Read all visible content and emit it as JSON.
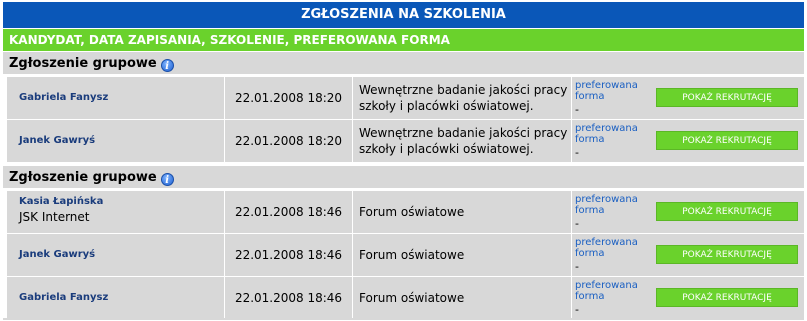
{
  "header": {
    "title": "ZGŁOSZENIA NA SZKOLENIA"
  },
  "columns_label": "KANDYDAT, DATA ZAPISANIA, SZKOLENIE, PREFEROWANA FORMA",
  "groups": [
    {
      "label": "Zgłoszenie grupowe",
      "rows": [
        {
          "name": "Gabriela Fanysz",
          "org": "",
          "date": "22.01.2008 18:20",
          "course_line1": "Wewnętrzne badanie jakości pracy",
          "course_line2": "szkoły i placówki oświatowej.",
          "pref_label_line1": "preferowana",
          "pref_label_line2": "forma",
          "pref_value": "-",
          "button": "POKAŻ REKRUTACJĘ"
        },
        {
          "name": "Janek Gawryś",
          "org": "",
          "date": "22.01.2008 18:20",
          "course_line1": "Wewnętrzne badanie jakości pracy",
          "course_line2": "szkoły i placówki oświatowej.",
          "pref_label_line1": "preferowana",
          "pref_label_line2": "forma",
          "pref_value": "-",
          "button": "POKAŻ REKRUTACJĘ"
        }
      ]
    },
    {
      "label": "Zgłoszenie grupowe",
      "rows": [
        {
          "name": "Kasia Łapińska",
          "org": "JSK Internet",
          "date": "22.01.2008 18:46",
          "course_line1": "Forum oświatowe",
          "course_line2": "",
          "pref_label_line1": "preferowana",
          "pref_label_line2": "forma",
          "pref_value": "-",
          "button": "POKAŻ REKRUTACJĘ"
        },
        {
          "name": "Janek Gawryś",
          "org": "",
          "date": "22.01.2008 18:46",
          "course_line1": "Forum oświatowe",
          "course_line2": "",
          "pref_label_line1": "preferowana",
          "pref_label_line2": "forma",
          "pref_value": "-",
          "button": "POKAŻ REKRUTACJĘ"
        },
        {
          "name": "Gabriela Fanysz",
          "org": "",
          "date": "22.01.2008 18:46",
          "course_line1": "Forum oświatowe",
          "course_line2": "",
          "pref_label_line1": "preferowana",
          "pref_label_line2": "forma",
          "pref_value": "-",
          "button": "POKAŻ REKRUTACJĘ"
        }
      ]
    }
  ]
}
